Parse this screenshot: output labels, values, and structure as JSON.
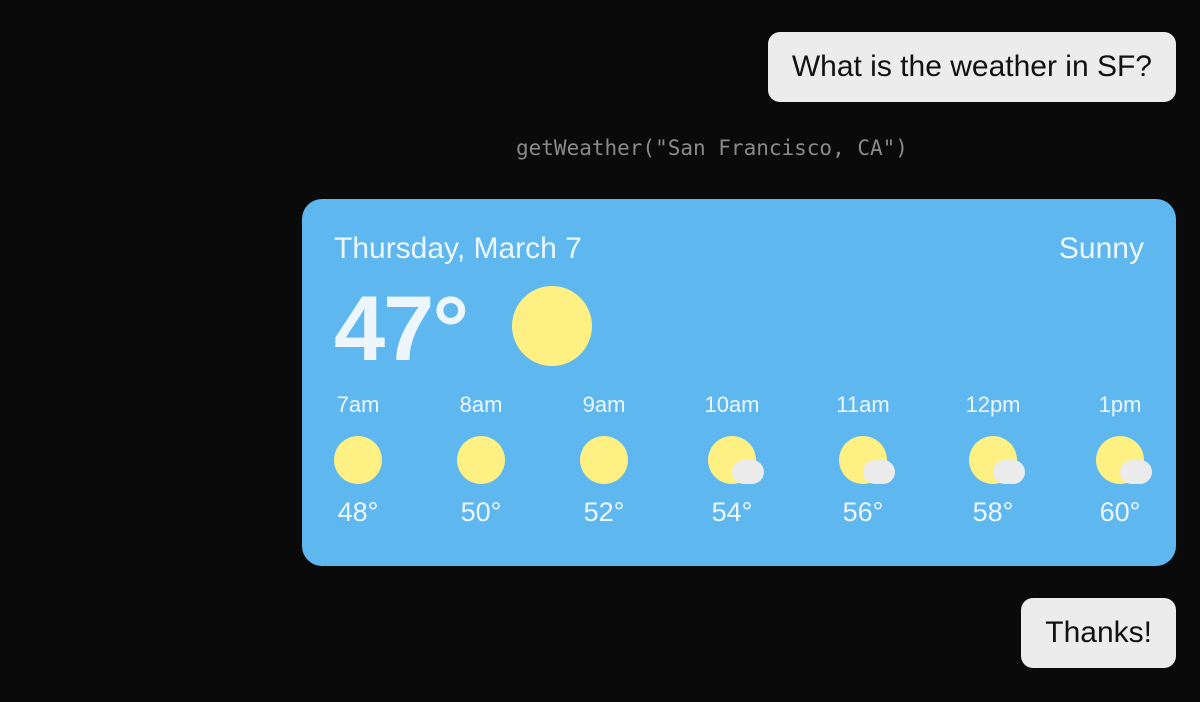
{
  "messages": {
    "question": "What is the weather in SF?",
    "tool_call": "getWeather(\"San Francisco, CA\")",
    "reply": "Thanks!"
  },
  "weather": {
    "date": "Thursday, March 7",
    "condition": "Sunny",
    "current_temp": "47°",
    "icon": "sun-icon",
    "hourly": [
      {
        "time": "7am",
        "temp": "48°",
        "icon": "sun"
      },
      {
        "time": "8am",
        "temp": "50°",
        "icon": "sun"
      },
      {
        "time": "9am",
        "temp": "52°",
        "icon": "sun"
      },
      {
        "time": "10am",
        "temp": "54°",
        "icon": "partly-cloudy"
      },
      {
        "time": "11am",
        "temp": "56°",
        "icon": "partly-cloudy"
      },
      {
        "time": "12pm",
        "temp": "58°",
        "icon": "partly-cloudy"
      },
      {
        "time": "1pm",
        "temp": "60°",
        "icon": "partly-cloudy"
      }
    ]
  },
  "colors": {
    "card": "#5fb7ef",
    "sun": "#fff084",
    "cloud": "#ebebeb",
    "background": "#0a0a0a"
  }
}
